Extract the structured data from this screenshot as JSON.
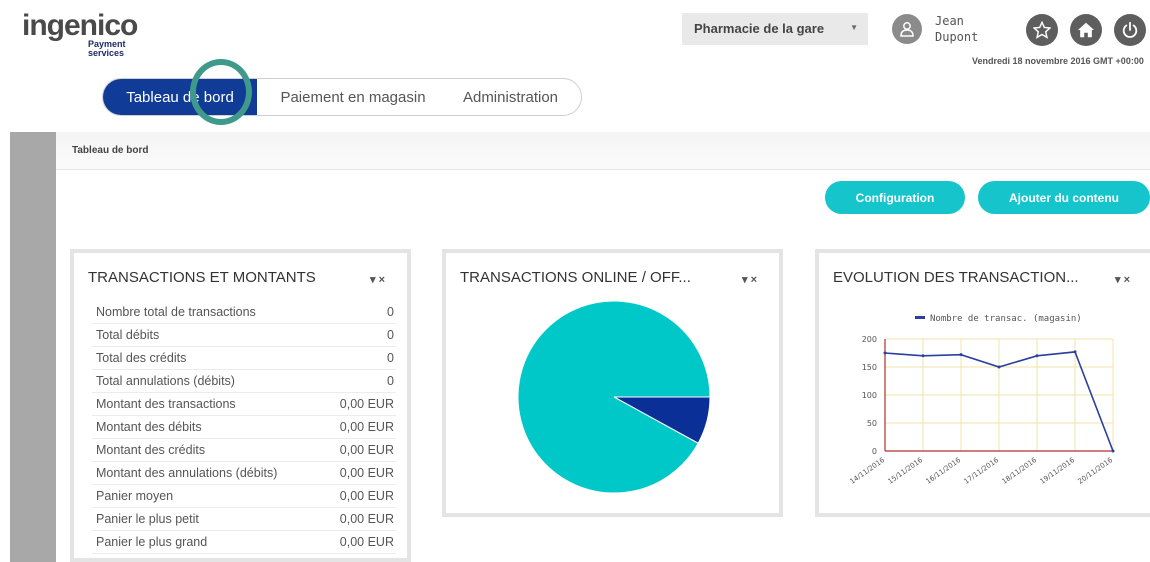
{
  "header": {
    "logo_main": "ingenico",
    "logo_sub_1": "Payment",
    "logo_sub_2": "services",
    "store_select": "Pharmacie de la gare",
    "user_first": "Jean",
    "user_last": "Dupont",
    "date": "Vendredi 18 novembre 2016 GMT +00:00"
  },
  "nav": {
    "tabs": [
      "Tableau de bord",
      "Paiement en magasin",
      "Administration"
    ]
  },
  "breadcrumb": "Tableau de bord",
  "actions": {
    "config": "Configuration",
    "add": "Ajouter du contenu"
  },
  "widget1": {
    "title": "TRANSACTIONS ET MONTANTS",
    "rows": [
      {
        "label": "Nombre total de transactions",
        "value": "0"
      },
      {
        "label": "Total débits",
        "value": "0"
      },
      {
        "label": "Total des crédits",
        "value": "0"
      },
      {
        "label": "Total annulations (débits)",
        "value": "0"
      },
      {
        "label": "Montant des transactions",
        "value": "0,00 EUR"
      },
      {
        "label": "Montant des débits",
        "value": "0,00 EUR"
      },
      {
        "label": "Montant des crédits",
        "value": "0,00 EUR"
      },
      {
        "label": "Montant des annulations (débits)",
        "value": "0,00 EUR"
      },
      {
        "label": "Panier moyen",
        "value": "0,00 EUR"
      },
      {
        "label": "Panier le plus petit",
        "value": "0,00 EUR"
      },
      {
        "label": "Panier le plus grand",
        "value": "0,00 EUR"
      }
    ]
  },
  "widget2": {
    "title": "TRANSACTIONS ONLINE / OFF..."
  },
  "widget3": {
    "title": "EVOLUTION DES TRANSACTION..."
  },
  "tools": {
    "caret": "▾",
    "close": "×"
  },
  "colors": {
    "primary": "#103b96",
    "accent": "#16c4cc",
    "pie_main": "#00c8c8",
    "pie_small": "#0a2f96",
    "line": "#2b3fa0",
    "grid": "#f2e3a8",
    "axis": "#b03030"
  },
  "chart_data": [
    {
      "type": "pie",
      "labels": [
        "",
        ""
      ],
      "values": [
        92,
        8
      ]
    },
    {
      "type": "line",
      "categories": [
        "14/11/2016",
        "15/11/2016",
        "16/11/2016",
        "17/11/2016",
        "18/11/2016",
        "19/11/2016",
        "20/11/2016"
      ],
      "series": [
        {
          "name": "Nombre de transac. (magasin)",
          "values": [
            175,
            170,
            172,
            150,
            170,
            177,
            0
          ]
        }
      ],
      "yticks": [
        0,
        50,
        100,
        150,
        200
      ],
      "ylim": [
        0,
        200
      ],
      "legend": "top",
      "grid": true
    }
  ]
}
